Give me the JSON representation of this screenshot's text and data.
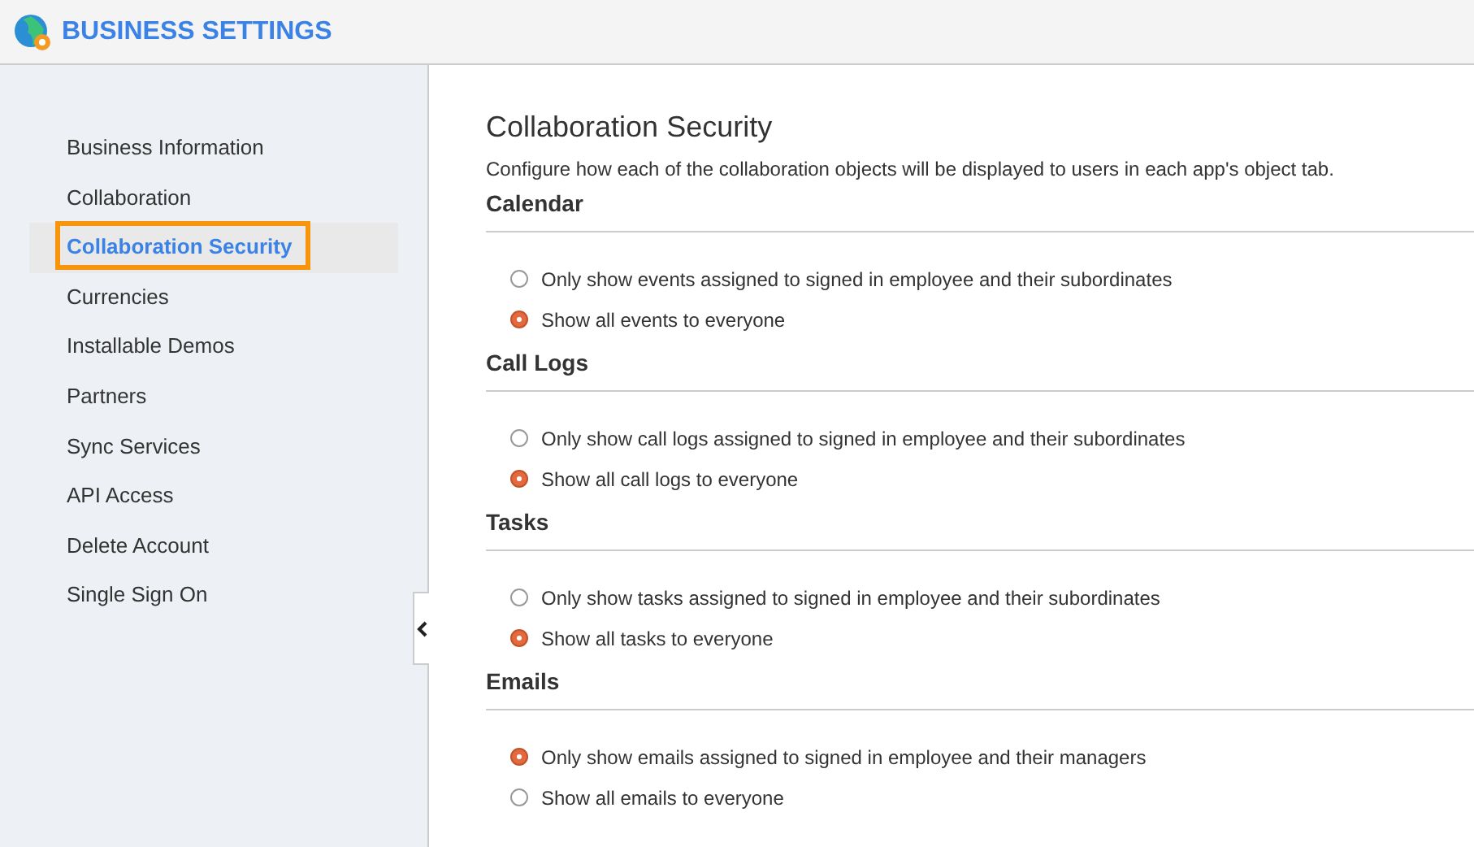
{
  "header": {
    "title": "BUSINESS SETTINGS"
  },
  "sidebar": {
    "items": [
      {
        "label": "Business Information",
        "selected": false
      },
      {
        "label": "Collaboration",
        "selected": false
      },
      {
        "label": "Collaboration Security",
        "selected": true
      },
      {
        "label": "Currencies",
        "selected": false
      },
      {
        "label": "Installable Demos",
        "selected": false
      },
      {
        "label": "Partners",
        "selected": false
      },
      {
        "label": "Sync Services",
        "selected": false
      },
      {
        "label": "API Access",
        "selected": false
      },
      {
        "label": "Delete Account",
        "selected": false
      },
      {
        "label": "Single Sign On",
        "selected": false
      }
    ]
  },
  "content": {
    "title": "Collaboration Security",
    "description": "Configure how each of the collaboration objects will be displayed to users in each app's object tab.",
    "sections": [
      {
        "heading": "Calendar",
        "options": [
          {
            "label": "Only show events assigned to signed in employee and their subordinates",
            "selected": false
          },
          {
            "label": "Show all events to everyone",
            "selected": true
          }
        ]
      },
      {
        "heading": "Call Logs",
        "options": [
          {
            "label": "Only show call logs assigned to signed in employee and their subordinates",
            "selected": false
          },
          {
            "label": "Show all call logs to everyone",
            "selected": true
          }
        ]
      },
      {
        "heading": "Tasks",
        "options": [
          {
            "label": "Only show tasks assigned to signed in employee and their subordinates",
            "selected": false
          },
          {
            "label": "Show all tasks to everyone",
            "selected": true
          }
        ]
      },
      {
        "heading": "Emails",
        "options": [
          {
            "label": "Only show emails assigned to signed in employee and their managers",
            "selected": true
          },
          {
            "label": "Show all emails to everyone",
            "selected": false
          }
        ]
      }
    ]
  }
}
